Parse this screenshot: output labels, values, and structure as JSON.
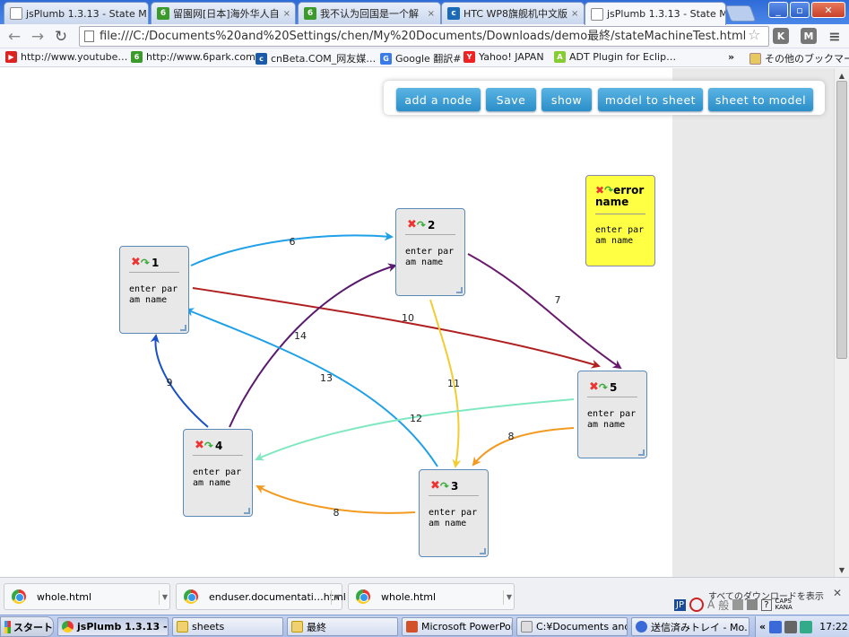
{
  "browser": {
    "tabs": [
      {
        "label": "jsPlumb 1.3.13 - State M",
        "favicon": "doc-icon",
        "active": false
      },
      {
        "label": "留園网[日本]海外华人自",
        "favicon": "6park-icon",
        "active": false
      },
      {
        "label": "我不认为回国是一个解",
        "favicon": "6park-icon",
        "active": false
      },
      {
        "label": "HTC WP8旗舰机中文版",
        "favicon": "cnbeta-icon",
        "active": false
      },
      {
        "label": "jsPlumb 1.3.13 - State M",
        "favicon": "doc-icon",
        "active": true
      }
    ],
    "tab_close": "×",
    "address": "file:///C:/Documents%20and%20Settings/chen/My%20Documents/Downloads/demo最終/stateMachineTest.html",
    "bookmarks": [
      {
        "label": "http://www.youtube…",
        "icon": "youtube-icon"
      },
      {
        "label": "http://www.6park.com/",
        "icon": "6park-icon"
      },
      {
        "label": "cnBeta.COM_网友媒…",
        "icon": "cnbeta-icon"
      },
      {
        "label": "Google 翻訳#",
        "icon": "google-translate-icon"
      },
      {
        "label": "Yahoo! JAPAN",
        "icon": "yahoo-icon"
      },
      {
        "label": "ADT Plugin for Eclip…",
        "icon": "android-icon"
      }
    ],
    "bookmarks_overflow": "»",
    "other_bookmarks": "その他のブックマーク"
  },
  "app": {
    "buttons": [
      "add a node",
      "Save",
      "show",
      "model to sheet",
      "sheet to model"
    ],
    "nodes": [
      {
        "id": "1",
        "text": "enter param name"
      },
      {
        "id": "2",
        "text": "enter param name"
      },
      {
        "id": "3",
        "text": "enter param name"
      },
      {
        "id": "4",
        "text": "enter param name"
      },
      {
        "id": "5",
        "text": "enter param name"
      }
    ],
    "error_node": {
      "title": "error name",
      "text": "enter param name"
    },
    "edges": [
      {
        "label": "6",
        "from": "1",
        "to": "2",
        "color": "#1ea0e8"
      },
      {
        "label": "7",
        "from": "2",
        "to": "5",
        "color": "#6a1a6e"
      },
      {
        "label": "10",
        "from": "1",
        "to": "5",
        "color": "#b02020"
      },
      {
        "label": "11",
        "from": "2",
        "to": "3",
        "color": "#f2cc30"
      },
      {
        "label": "14",
        "from": "4",
        "to": "2",
        "color": "#5a1a6e"
      },
      {
        "label": "13",
        "from": "3",
        "to": "1",
        "color": "#1ea0e8"
      },
      {
        "label": "9",
        "from": "4",
        "to": "1",
        "color": "#1a50c8"
      },
      {
        "label": "12",
        "from": "5",
        "to": "4",
        "color": "#80e8c0"
      },
      {
        "label": "8",
        "from": "5",
        "to": "3",
        "color": "#f29a20"
      },
      {
        "label": "8",
        "from": "3",
        "to": "4",
        "color": "#f29a20"
      }
    ]
  },
  "downloads": [
    {
      "label": "whole.html"
    },
    {
      "label": "enduser.documentati…html"
    },
    {
      "label": "whole.html"
    }
  ],
  "ime_text": "すべてのダウンロードを表示",
  "taskbar": {
    "start": "スタート",
    "tasks": [
      {
        "label": "jsPlumb 1.3.13 -…",
        "icon": "chrome-icon",
        "active": true
      },
      {
        "label": "sheets",
        "icon": "folder-icon",
        "active": false
      },
      {
        "label": "最終",
        "icon": "folder-icon",
        "active": false
      },
      {
        "label": "Microsoft PowerPoi…",
        "icon": "powerpoint-icon",
        "active": false
      },
      {
        "label": "C:¥Documents and …",
        "icon": "explorer-icon",
        "active": false
      },
      {
        "label": "送信済みトレイ - Mo…",
        "icon": "mail-icon",
        "active": false
      }
    ],
    "tray_overflow": "«",
    "clock": "17:22"
  }
}
